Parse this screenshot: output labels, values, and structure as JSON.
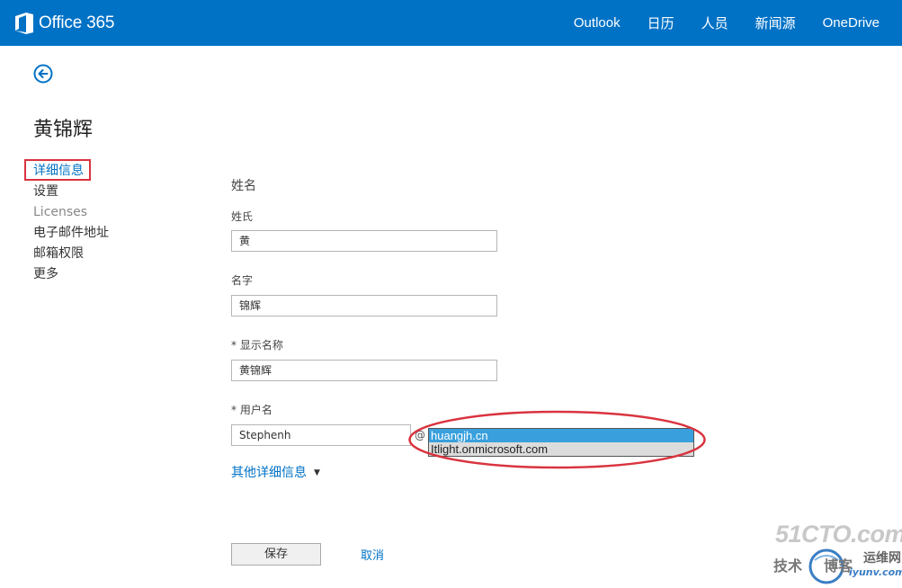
{
  "header": {
    "brand": "Office 365",
    "nav": [
      "Outlook",
      "日历",
      "人员",
      "新闻源",
      "OneDrive"
    ]
  },
  "page": {
    "title": "黄锦辉"
  },
  "sidebar": {
    "items": [
      {
        "label": "详细信息",
        "active": true
      },
      {
        "label": "设置"
      },
      {
        "label": "Licenses"
      },
      {
        "label": "电子邮件地址"
      },
      {
        "label": "邮箱权限"
      },
      {
        "label": "更多"
      }
    ]
  },
  "form": {
    "section_title": "姓名",
    "last_name": {
      "label": "姓氏",
      "value": "黄"
    },
    "first_name": {
      "label": "名字",
      "value": "锦辉"
    },
    "display_name": {
      "label": "* 显示名称",
      "value": "黄锦辉"
    },
    "username": {
      "label": "* 用户名",
      "value": "Stephenh",
      "at": "@"
    },
    "domains": {
      "options": [
        "huangjh.cn",
        "Itlight.onmicrosoft.com"
      ],
      "selected": "huangjh.cn"
    },
    "more_details": "其他详细信息",
    "save": "保存",
    "cancel": "取消"
  },
  "watermark": {
    "site": "51CTO.com",
    "line1": "技术",
    "line2": "博客",
    "line3": "运维网",
    "url": "iyunv.com"
  },
  "colors": {
    "brand_blue": "#0072c6",
    "highlight_red": "#d9343f",
    "selected_option": "#3aa0dd"
  }
}
